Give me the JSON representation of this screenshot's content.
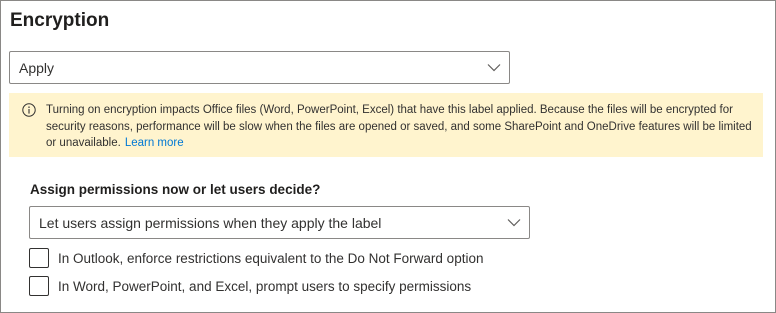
{
  "section": {
    "title": "Encryption"
  },
  "encryption_dropdown": {
    "selected": "Apply",
    "icon": "chevron-down-icon"
  },
  "banner": {
    "icon": "info-icon",
    "message": "Turning on encryption impacts Office files (Word, PowerPoint, Excel) that have this label applied. Because the files will be encrypted for security reasons, performance will be slow when the files are opened or saved, and some SharePoint and OneDrive features will be limited or unavailable.",
    "link_text": "Learn more",
    "background_color": "#fff4ce",
    "link_color": "#0078d4"
  },
  "permissions": {
    "question": "Assign permissions now or let users decide?",
    "dropdown": {
      "selected": "Let users assign permissions when they apply the label",
      "icon": "chevron-down-icon"
    },
    "options": [
      {
        "label": "In Outlook, enforce restrictions equivalent to the Do Not Forward option",
        "checked": false
      },
      {
        "label": "In Word, PowerPoint, and Excel, prompt users to specify permissions",
        "checked": false
      }
    ]
  }
}
